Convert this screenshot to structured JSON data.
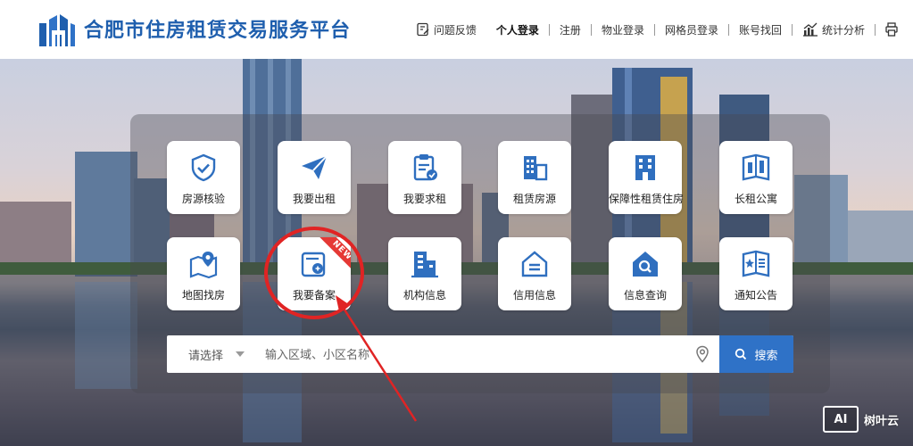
{
  "header": {
    "site_title": "合肥市住房租赁交易服务平台",
    "brand_color": "#1f5fae",
    "nav": [
      {
        "label": "问题反馈",
        "icon": "feedback-icon"
      },
      {
        "label": "个人登录",
        "active": true
      },
      {
        "label": "注册"
      },
      {
        "label": "物业登录"
      },
      {
        "label": "网格员登录"
      },
      {
        "label": "账号找回"
      },
      {
        "label": "统计分析",
        "icon": "chart-icon"
      },
      {
        "label": "",
        "icon": "print-icon"
      }
    ]
  },
  "tiles": [
    {
      "label": "房源核验",
      "icon": "shield-check-icon"
    },
    {
      "label": "我要出租",
      "icon": "paper-plane-icon"
    },
    {
      "label": "我要求租",
      "icon": "clipboard-check-icon"
    },
    {
      "label": "租赁房源",
      "icon": "building-icon"
    },
    {
      "label": "保障性租赁住房",
      "icon": "apartment-icon"
    },
    {
      "label": "长租公寓",
      "icon": "book-building-icon"
    },
    {
      "label": "地图找房",
      "icon": "map-pin-icon"
    },
    {
      "label": "我要备案",
      "icon": "record-icon",
      "badge": "NEW"
    },
    {
      "label": "机构信息",
      "icon": "office-icon"
    },
    {
      "label": "信用信息",
      "icon": "credit-house-icon"
    },
    {
      "label": "信息查询",
      "icon": "house-search-icon"
    },
    {
      "label": "通知公告",
      "icon": "notice-icon"
    }
  ],
  "search": {
    "select_label": "请选择",
    "placeholder": "输入区域、小区名称",
    "button_label": "搜索",
    "accent": "#2f72c7"
  },
  "annotation": {
    "color": "#e02424"
  },
  "watermark": {
    "box_text": "AI",
    "text": "树叶云"
  }
}
